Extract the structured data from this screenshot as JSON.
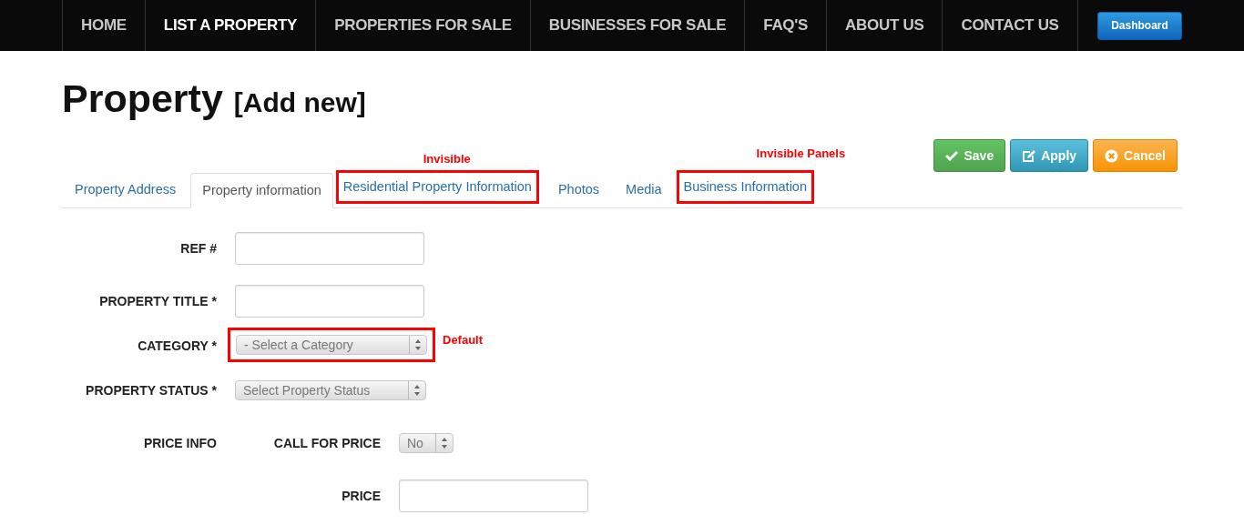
{
  "nav": {
    "items": [
      {
        "label": "HOME",
        "selected": false
      },
      {
        "label": "LIST A PROPERTY",
        "selected": true
      },
      {
        "label": "PROPERTIES FOR SALE",
        "selected": false
      },
      {
        "label": "BUSINESSES FOR SALE",
        "selected": false
      },
      {
        "label": "FAQ'S",
        "selected": false
      },
      {
        "label": "ABOUT US",
        "selected": false
      },
      {
        "label": "CONTACT US",
        "selected": false
      }
    ],
    "dashboard_button": "Dashboard"
  },
  "title": "Property",
  "subtitle": "[Add new]",
  "actions": [
    {
      "label": "Save",
      "kind": "save"
    },
    {
      "label": "Apply",
      "kind": "apply"
    },
    {
      "label": "Cancel",
      "kind": "cancel"
    }
  ],
  "tabs": [
    {
      "label": "Property Address",
      "selected": false,
      "highlighted": false
    },
    {
      "label": "Property information",
      "selected": true,
      "highlighted": false
    },
    {
      "label": "Residential Property Information",
      "selected": false,
      "highlighted": true,
      "annotation": "Invisible"
    },
    {
      "label": "Photos",
      "selected": false,
      "highlighted": false
    },
    {
      "label": "Media",
      "selected": false,
      "highlighted": false
    },
    {
      "label": "Business Information",
      "selected": false,
      "highlighted": true,
      "annotation": "Invisible Panels"
    }
  ],
  "form": {
    "rows": [
      {
        "label": "REF #",
        "kind": "text",
        "highlighted": false
      },
      {
        "label": "PROPERTY TITLE *",
        "kind": "text",
        "highlighted": false
      },
      {
        "label": "CATEGORY *",
        "kind": "select",
        "value": "- Select a Category",
        "highlighted": true,
        "annotation": "Default"
      },
      {
        "label": "PROPERTY STATUS *",
        "kind": "select",
        "value": "Select Property Status",
        "highlighted": false
      },
      {
        "label": "PRICE INFO",
        "kind": "inline",
        "field": {
          "label": "CALL FOR PRICE",
          "kind": "select",
          "value": "No"
        }
      },
      {
        "kind": "inline",
        "field": {
          "label": "PRICE",
          "kind": "text"
        }
      }
    ]
  }
}
